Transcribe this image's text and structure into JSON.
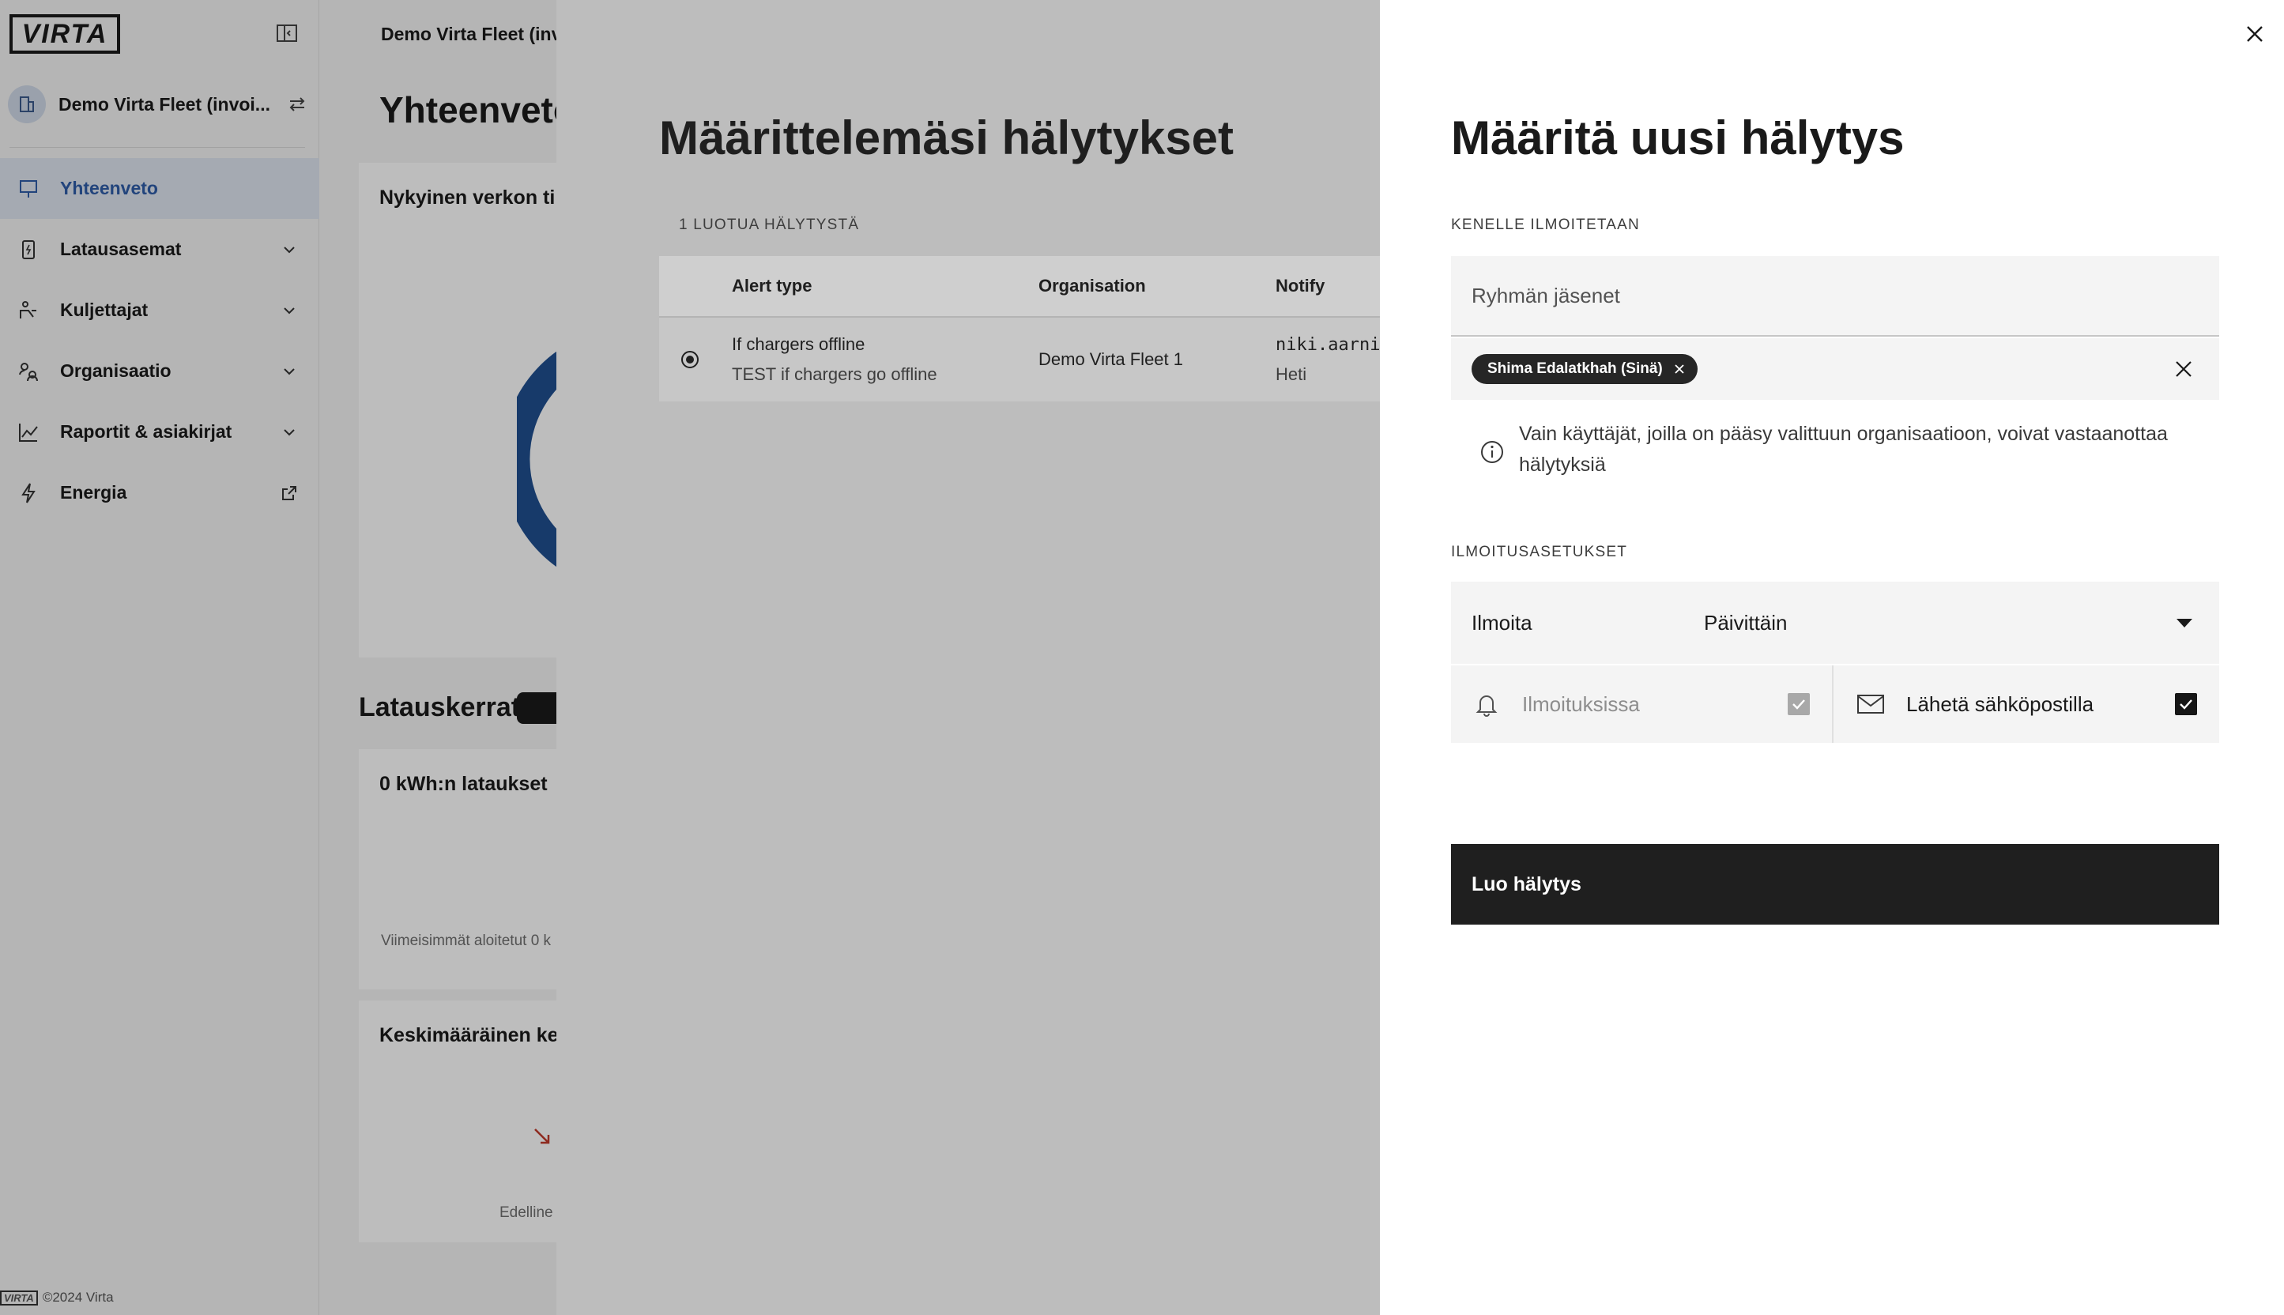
{
  "app": {
    "logo_text": "VIRTA",
    "org_name": "Demo Virta Fleet (invoi...",
    "nav": [
      {
        "label": "Yhteenveto",
        "active": true
      },
      {
        "label": "Latausasemat"
      },
      {
        "label": "Kuljettajat"
      },
      {
        "label": "Organisaatio"
      },
      {
        "label": "Raportit & asiakirjat"
      },
      {
        "label": "Energia"
      }
    ],
    "footer": "©2024 Virta",
    "breadcrumb": "Demo Virta Fleet (inv",
    "page_title": "Yhteenveto",
    "card_network_title": "Nykyinen verkon ti",
    "section_title": "Latauskerrat",
    "card_kwh_title": "0 kWh:n lataukset",
    "card_kwh_note": "Viimeisimmät aloitetut 0 k",
    "card_avg_title": "Keskimääräinen ke",
    "card_avg_note": "Edelline"
  },
  "alerts_list": {
    "title": "Määrittelemäsi hälytykset",
    "count_label": "1 LUOTUA HÄLYTYSTÄ",
    "columns": [
      "Alert type",
      "Organisation",
      "Notify"
    ],
    "rows": [
      {
        "alert_type": "If chargers offline",
        "description": "TEST if chargers go offline",
        "organisation": "Demo Virta Fleet 1",
        "notify": "niki.aarni",
        "frequency": "Heti"
      }
    ]
  },
  "form": {
    "title": "Määritä uusi hälytys",
    "recipients_label": "KENELLE ILMOITETAAN",
    "members_placeholder": "Ryhmän jäsenet",
    "selected_members": [
      "Shima Edalatkhah (Sinä)"
    ],
    "info_text": "Vain käyttäjät, joilla on pääsy valittuun organisaatioon, voivat vastaanottaa hälytyksiä",
    "settings_label": "ILMOITUSASETUKSET",
    "notify_label": "Ilmoita",
    "notify_value": "Päivittäin",
    "channel_in_app": "Ilmoituksissa",
    "channel_in_app_checked": true,
    "channel_in_app_disabled": true,
    "channel_email": "Lähetä sähköpostilla",
    "channel_email_checked": true,
    "submit_label": "Luo hälytys"
  },
  "colors": {
    "active_nav": "#2f5ca8",
    "primary_button": "#1f1f1f"
  }
}
